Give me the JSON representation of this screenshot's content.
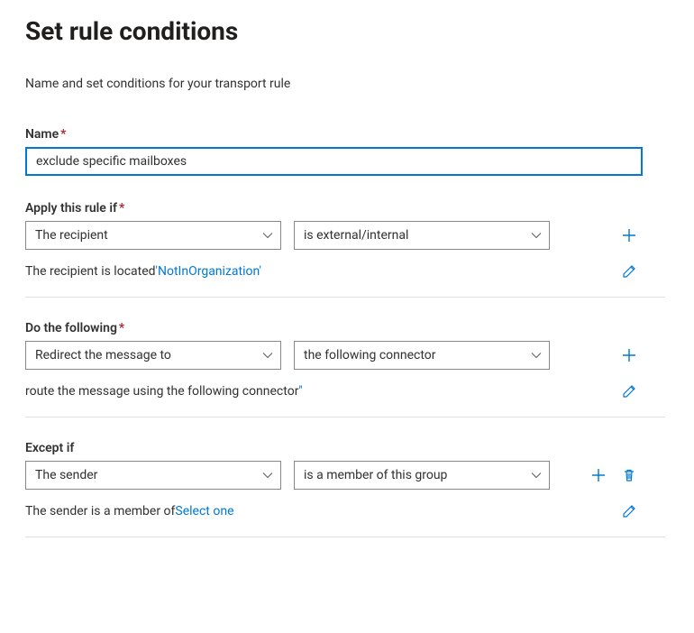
{
  "title": "Set rule conditions",
  "subtitle": "Name and set conditions for your transport rule",
  "name_field": {
    "label": "Name",
    "value": "exclude specific mailboxes"
  },
  "apply_if": {
    "label": "Apply this rule if",
    "select1": "The recipient",
    "select2": "is external/internal",
    "summary_prefix": "The recipient is located ",
    "summary_link": "'NotInOrganization'"
  },
  "do_following": {
    "label": "Do the following",
    "select1": "Redirect the message to",
    "select2": "the following connector",
    "summary_prefix": "route the message using the following connector ",
    "summary_link": "''"
  },
  "except_if": {
    "label": "Except if",
    "select1": "The sender",
    "select2": "is a member of this group",
    "summary_prefix": "The sender is a member of ",
    "summary_link": "Select one"
  }
}
